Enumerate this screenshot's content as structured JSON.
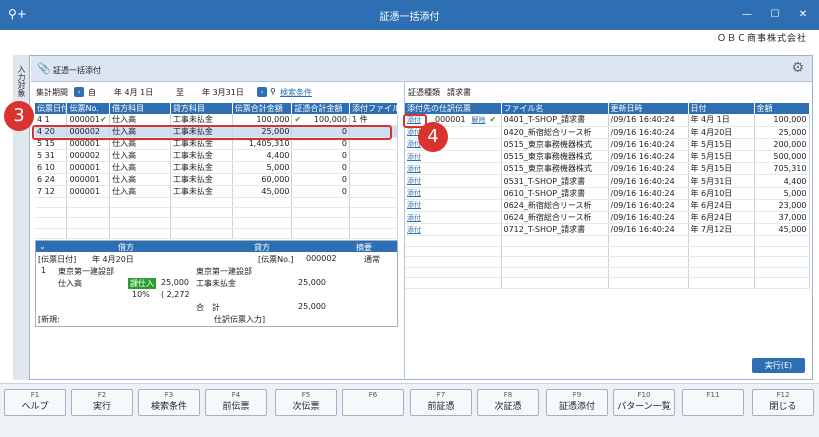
{
  "window": {
    "title": "証憑一括添付",
    "company": "ＯＢＣ商事株式会社"
  },
  "side_tab": "入力対象",
  "panel": {
    "title": "証憑一括添付"
  },
  "period": {
    "label": "集計期間",
    "from_prefix": "自",
    "from": "年 4月 1日",
    "to_prefix": "至",
    "to": "年 3月31日",
    "search_link": "検索条件"
  },
  "journal_table": {
    "headers": [
      "伝票日付",
      "伝票No.",
      "借方科目",
      "貸方科目",
      "伝票合計金額",
      "証憑合計金額",
      "添付ファイル"
    ],
    "rows": [
      {
        "date": "4  1",
        "no": "000001",
        "debit": "仕入高",
        "credit": "工事未払金",
        "total": "100,000",
        "evid": "100,000",
        "attach": "1 件",
        "check": "✔",
        "selected": false
      },
      {
        "date": "4  20",
        "no": "000002",
        "debit": "仕入高",
        "credit": "工事未払金",
        "total": "25,000",
        "evid": "0",
        "attach": "",
        "check": "",
        "selected": true
      },
      {
        "date": "5  15",
        "no": "000001",
        "debit": "仕入高",
        "credit": "工事未払金",
        "total": "1,405,310",
        "evid": "0",
        "attach": "",
        "check": "",
        "selected": false
      },
      {
        "date": "5  31",
        "no": "000002",
        "debit": "仕入高",
        "credit": "工事未払金",
        "total": "4,400",
        "evid": "0",
        "attach": "",
        "check": "",
        "selected": false
      },
      {
        "date": "6  10",
        "no": "000001",
        "debit": "仕入高",
        "credit": "工事未払金",
        "total": "5,000",
        "evid": "0",
        "attach": "",
        "check": "",
        "selected": false
      },
      {
        "date": "6  24",
        "no": "000001",
        "debit": "仕入高",
        "credit": "工事未払金",
        "total": "60,000",
        "evid": "0",
        "attach": "",
        "check": "",
        "selected": false
      },
      {
        "date": "7  12",
        "no": "000001",
        "debit": "仕入高",
        "credit": "工事未払金",
        "total": "45,000",
        "evid": "0",
        "attach": "",
        "check": "",
        "selected": false
      }
    ]
  },
  "detail": {
    "header": {
      "debit": "借方",
      "credit": "貸方",
      "memo": "摘要"
    },
    "date_label": "[伝票日付]",
    "date_value": "年 4月20日",
    "no_label": "[伝票No.]",
    "no_value": "000002",
    "type": "通常",
    "line_no": "1",
    "debit_dept": "東京第一建設部",
    "debit_account": "仕入高",
    "tax_badge": "課仕入",
    "debit_amount": "25,000",
    "tax_rate": "10%",
    "tax_amount": "( 2,272",
    "credit_dept": "東京第一建設部",
    "credit_account": "工事未払金",
    "credit_amount": "25,000",
    "total_label": "合　計",
    "total_amount": "25,000",
    "footer_prefix": "[新規:",
    "footer_suffix": "仕訳伝票入力]"
  },
  "evidence": {
    "type_label": "証憑種類",
    "type_value": "請求書",
    "headers": [
      "添付先の仕訳伝票",
      "ファイル名",
      "更新日時",
      "日付",
      "金額"
    ],
    "attach_link": "添付",
    "release_link": "解除",
    "attached_no": "000001",
    "rows": [
      {
        "file": "0401_T-SHOP_請求書",
        "updated": "/09/16 16:40:24",
        "date": "年  4月  1日",
        "amount": "100,000",
        "linked": true
      },
      {
        "file": "0420_新宿総合リース析",
        "updated": "/09/16 16:40:24",
        "date": "年  4月20日",
        "amount": "25,000",
        "linked": false
      },
      {
        "file": "0515_東京事務機器株式",
        "updated": "/09/16 16:40:24",
        "date": "年  5月15日",
        "amount": "200,000",
        "linked": false
      },
      {
        "file": "0515_東京事務機器株式",
        "updated": "/09/16 16:40:24",
        "date": "年  5月15日",
        "amount": "500,000",
        "linked": false
      },
      {
        "file": "0515_東京事務機器株式",
        "updated": "/09/16 16:40:24",
        "date": "年  5月15日",
        "amount": "705,310",
        "linked": false
      },
      {
        "file": "0531_T-SHOP_請求書",
        "updated": "/09/16 16:40:24",
        "date": "年  5月31日",
        "amount": "4,400",
        "linked": false
      },
      {
        "file": "0610_T-SHOP_請求書",
        "updated": "/09/16 16:40:24",
        "date": "年  6月10日",
        "amount": "5,000",
        "linked": false
      },
      {
        "file": "0624_新宿総合リース析",
        "updated": "/09/16 16:40:24",
        "date": "年  6月24日",
        "amount": "23,000",
        "linked": false
      },
      {
        "file": "0624_新宿総合リース析",
        "updated": "/09/16 16:40:24",
        "date": "年  6月24日",
        "amount": "37,000",
        "linked": false
      },
      {
        "file": "0712_T-SHOP_請求書",
        "updated": "/09/16 16:40:24",
        "date": "年  7月12日",
        "amount": "45,000",
        "linked": false
      }
    ]
  },
  "execute_label": "実行(E)",
  "fkeys": [
    {
      "key": "F1",
      "label": "ヘルプ"
    },
    {
      "key": "F2",
      "label": "実行"
    },
    {
      "key": "F3",
      "label": "検索条件"
    },
    {
      "key": "F4",
      "label": "前伝票"
    },
    {
      "key": "F5",
      "label": "次伝票"
    },
    {
      "key": "F6",
      "label": ""
    },
    {
      "key": "F7",
      "label": "前証憑"
    },
    {
      "key": "F8",
      "label": "次証憑"
    },
    {
      "key": "F9",
      "label": "証憑添付"
    },
    {
      "key": "F10",
      "label": "パターン一覧"
    },
    {
      "key": "F11",
      "label": ""
    },
    {
      "key": "F12",
      "label": "閉じる"
    }
  ],
  "callouts": {
    "c3": "3",
    "c4": "4"
  },
  "colors": {
    "accent": "#2e6fb3",
    "callout": "#d9332f",
    "selected_row": "#cfe0f3",
    "check": "#2a9d2a"
  },
  "icons": {
    "search": "search-icon",
    "gear": "gear-icon",
    "clip": "paperclip-icon"
  }
}
